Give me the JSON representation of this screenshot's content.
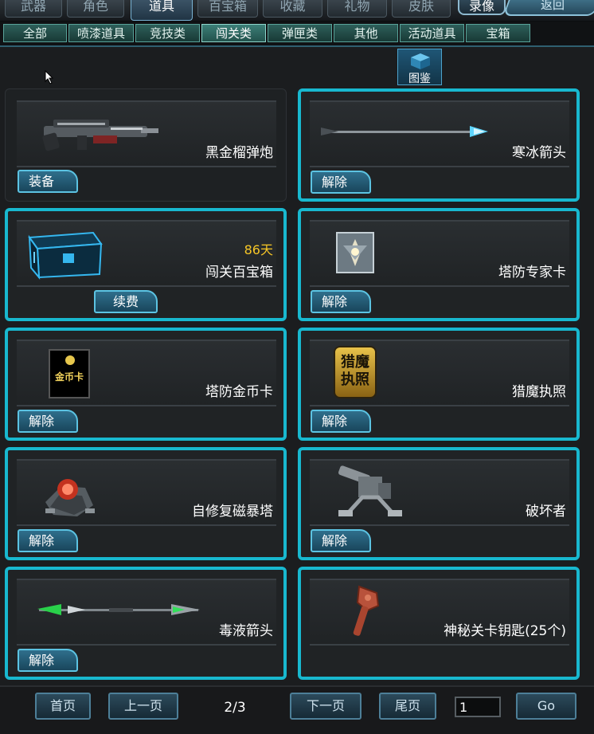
{
  "main_tabs": [
    "武器",
    "角色",
    "道具",
    "百宝箱",
    "收藏",
    "礼物",
    "皮肤",
    "录像"
  ],
  "back_label": "返回",
  "sub_tabs": [
    "全部",
    "喷漆道具",
    "竞技类",
    "闯关类",
    "弹匣类",
    "其他",
    "活动道具",
    "宝箱"
  ],
  "gallery_label": "图鉴",
  "items": [
    {
      "name": "黑金榴弹炮",
      "action": "装备",
      "icon": "grenade-launcher-icon"
    },
    {
      "name": "寒冰箭头",
      "action": "解除",
      "icon": "ice-arrow-icon"
    },
    {
      "name": "闯关百宝箱",
      "days": "86天",
      "action": "续费",
      "icon": "treasure-chest-icon"
    },
    {
      "name": "塔防专家卡",
      "action": "解除",
      "icon": "expert-card-icon"
    },
    {
      "name": "塔防金币卡",
      "action": "解除",
      "icon": "gold-card-icon",
      "icon_text": "金币卡"
    },
    {
      "name": "猎魔执照",
      "action": "解除",
      "icon": "demon-license-icon",
      "icon_text": "猎魔执照"
    },
    {
      "name": "自修复磁暴塔",
      "action": "解除",
      "icon": "tesla-tower-icon"
    },
    {
      "name": "破坏者",
      "action": "解除",
      "icon": "destroyer-turret-icon"
    },
    {
      "name": "毒液箭头",
      "action": "解除",
      "icon": "venom-arrow-icon"
    },
    {
      "name": "神秘关卡钥匙(25个)",
      "icon": "mystery-key-icon"
    }
  ],
  "pager": {
    "first": "首页",
    "prev": "上一页",
    "indicator": "2/3",
    "next": "下一页",
    "last": "尾页",
    "page_value": "1",
    "go": "Go"
  },
  "colors": {
    "card_border": "#18b8cf",
    "days": "#f6c626"
  }
}
